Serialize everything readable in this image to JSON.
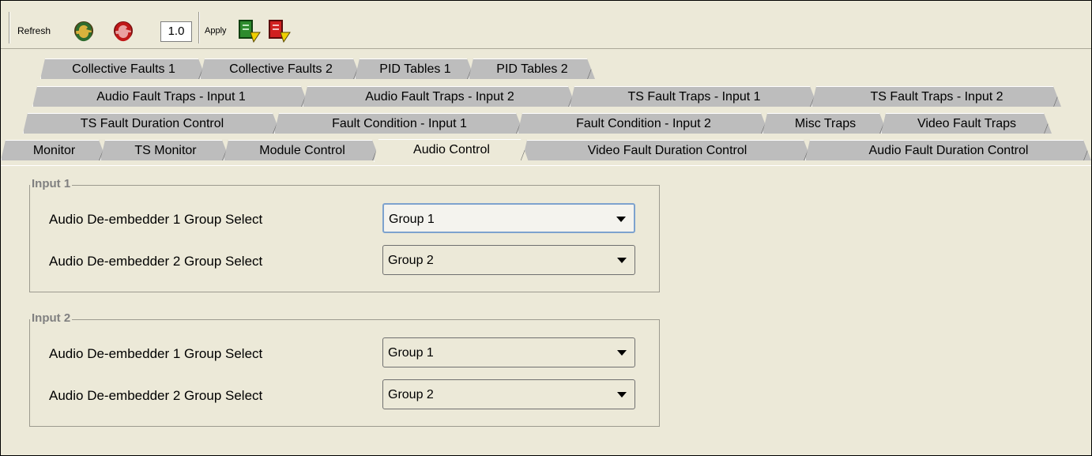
{
  "toolbar": {
    "refresh_label": "Refresh",
    "refresh_icon": "refresh-icon",
    "refresh_all_icon": "refresh-all-icon",
    "version": "1.0",
    "apply_label": "Apply",
    "apply_icon": "apply-icon",
    "apply_all_icon": "apply-all-icon"
  },
  "tabs": {
    "row1": [
      "Collective Faults 1",
      "Collective Faults 2",
      "PID Tables 1",
      "PID Tables 2"
    ],
    "row2": [
      "Audio Fault Traps - Input 1",
      "Audio Fault Traps - Input 2",
      "TS Fault Traps - Input 1",
      "TS Fault Traps - Input 2"
    ],
    "row3": [
      "TS Fault Duration Control",
      "Fault Condition - Input 1",
      "Fault Condition - Input 2",
      "Misc Traps",
      "Video Fault Traps"
    ],
    "row4": [
      "Monitor",
      "TS Monitor",
      "Module Control",
      "Audio Control",
      "Video Fault Duration Control",
      "Audio Fault Duration Control"
    ],
    "active": "Audio Control"
  },
  "input1": {
    "title": "Input 1",
    "deemb1_label": "Audio De-embedder 1 Group Select",
    "deemb1_value": "Group 1",
    "deemb2_label": "Audio De-embedder 2 Group Select",
    "deemb2_value": "Group 2"
  },
  "input2": {
    "title": "Input 2",
    "deemb1_label": "Audio De-embedder 1 Group Select",
    "deemb1_value": "Group 1",
    "deemb2_label": "Audio De-embedder 2 Group Select",
    "deemb2_value": "Group 2"
  },
  "colors": {
    "panel_bg": "#ece9d8",
    "tab_bg": "#bdbdbd",
    "focus_border": "#7da2ce",
    "group_title": "#808080"
  }
}
